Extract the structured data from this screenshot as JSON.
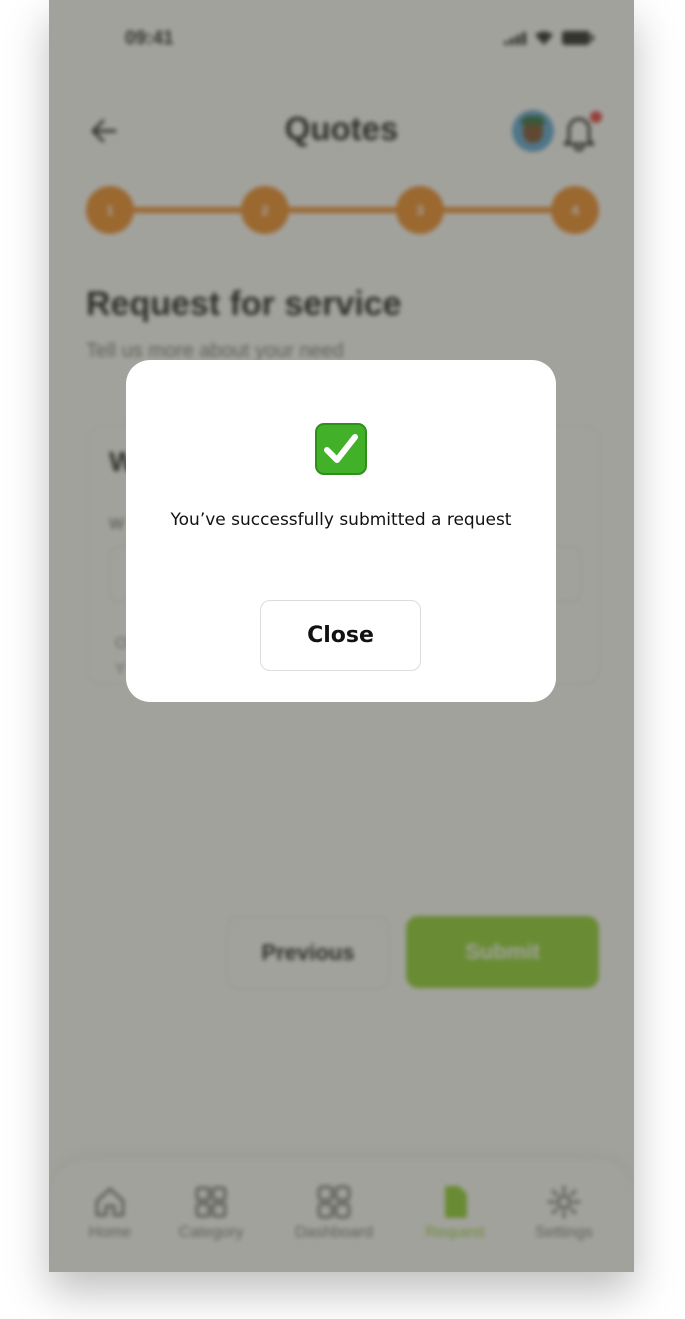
{
  "status_bar": {
    "time": "09:41"
  },
  "header": {
    "title": "Quotes"
  },
  "stepper": {
    "steps": [
      "1",
      "2",
      "3",
      "4"
    ],
    "color": "#f08a24"
  },
  "section": {
    "title": "Request for service",
    "subtitle": "Tell us more about your need"
  },
  "card": {
    "heading": "W",
    "field_label": "W",
    "note_line1": "O",
    "note_line2": "Y"
  },
  "actions": {
    "previous_label": "Previous",
    "submit_label": "Submit",
    "submit_color": "#8bd12a"
  },
  "bottom_nav": {
    "items": [
      {
        "label": "Home",
        "icon": "home-icon"
      },
      {
        "label": "Category",
        "icon": "category-icon"
      },
      {
        "label": "Dashboard",
        "icon": "dashboard-icon"
      },
      {
        "label": "Request",
        "icon": "document-icon",
        "active": true
      },
      {
        "label": "Settings",
        "icon": "gear-icon"
      }
    ]
  },
  "modal": {
    "icon": "check-box-icon",
    "message": "You’ve successfully submitted a request",
    "close_label": "Close"
  }
}
